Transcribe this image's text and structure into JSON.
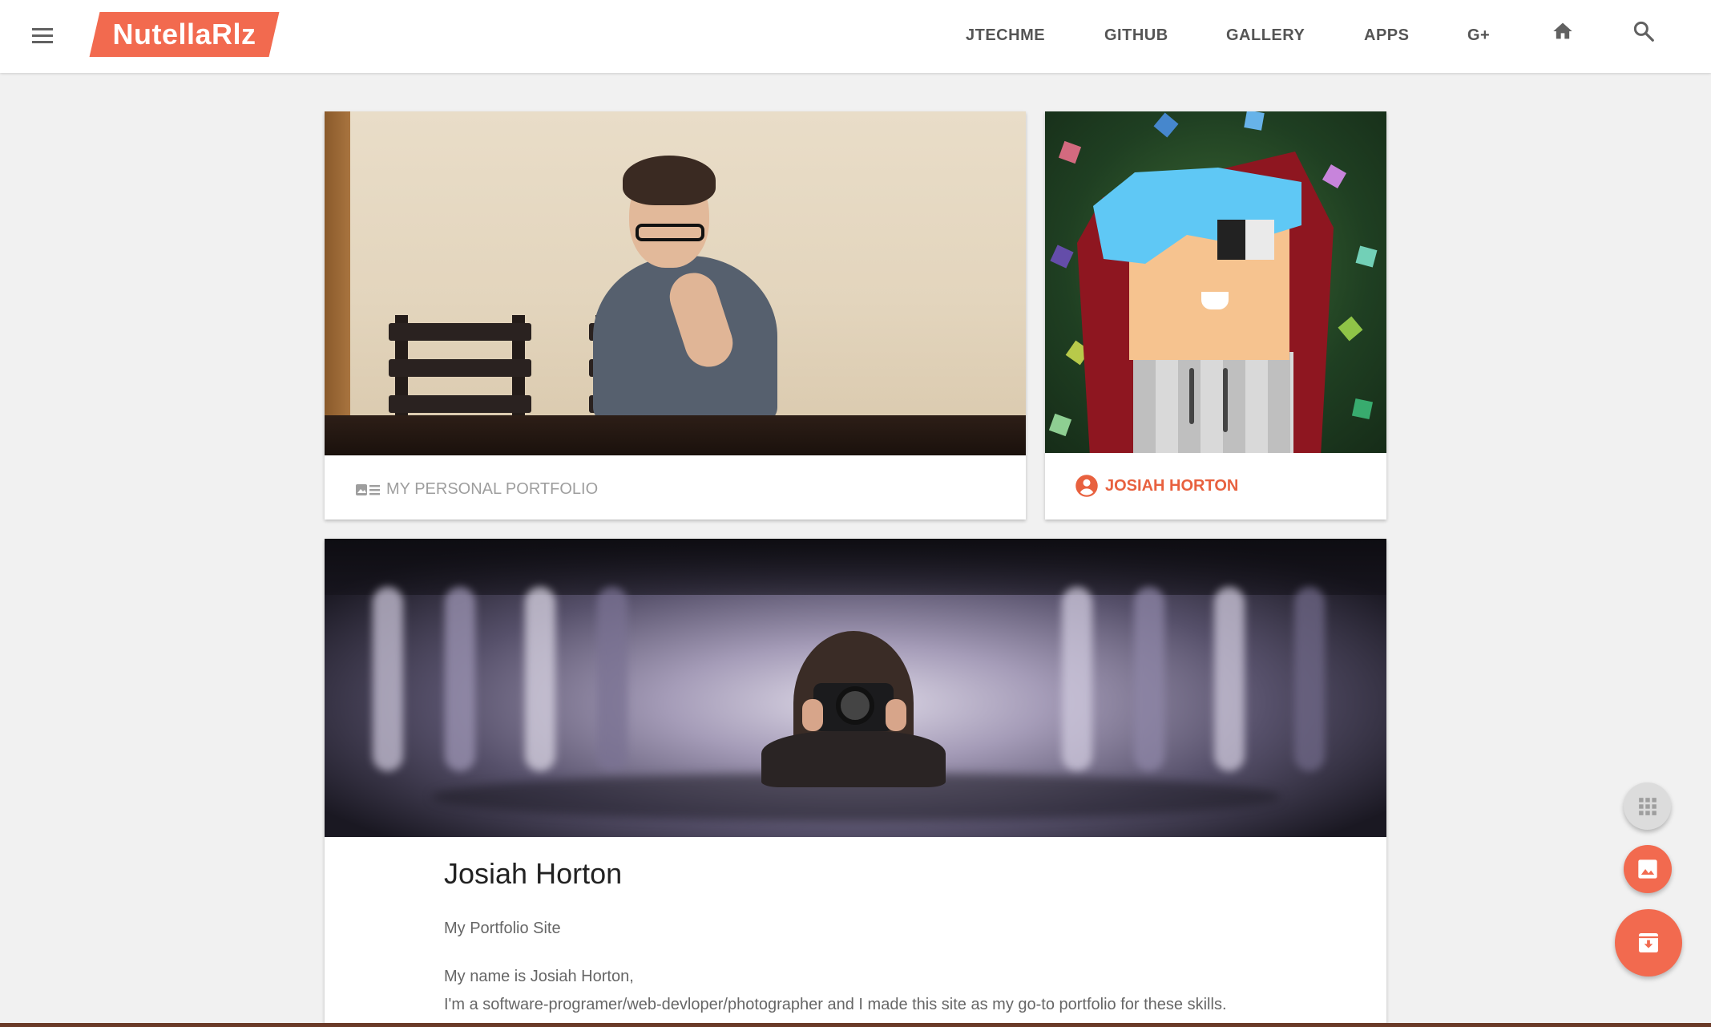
{
  "header": {
    "menu_icon": "menu-icon",
    "logo_text": "NutellaRlz",
    "brand_color": "#f26a4f",
    "nav": [
      "JTECHME",
      "GITHUB",
      "GALLERY",
      "APPS",
      "G+"
    ],
    "home_icon": "home-icon",
    "search_icon": "search-icon"
  },
  "cards": {
    "portfolio": {
      "icon": "portfolio-card-icon",
      "label": "MY PERSONAL PORTFOLIO"
    },
    "profile": {
      "icon": "account-circle-icon",
      "label": "JOSIAH HORTON"
    }
  },
  "article": {
    "title": "Josiah Horton",
    "subtitle": "My Portfolio Site",
    "lines": [
      "My name is Josiah Horton,",
      "I'm a software-programer/web-devloper/photographer and I made this site as my go-to portfolio for these skills."
    ]
  },
  "fabs": [
    {
      "icon": "apps-grid-icon",
      "color": "#dcdcdc"
    },
    {
      "icon": "image-icon",
      "color": "#f26a4f"
    },
    {
      "icon": "archive-icon",
      "color": "#f26a4f"
    }
  ]
}
